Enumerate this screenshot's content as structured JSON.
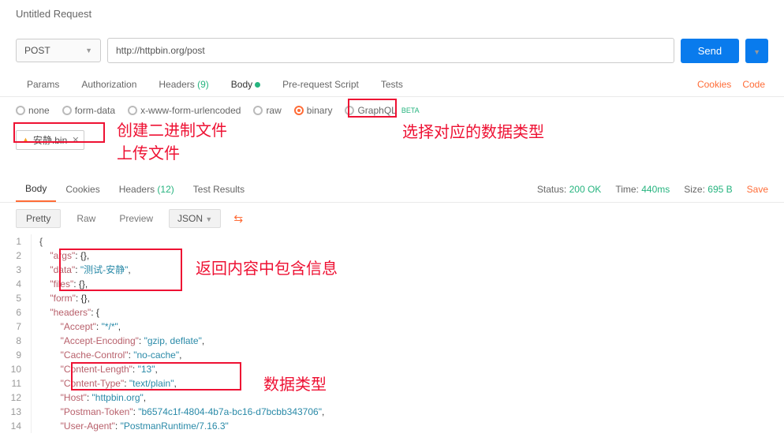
{
  "title": "Untitled Request",
  "request": {
    "method": "POST",
    "url": "http://httpbin.org/post",
    "send_label": "Send"
  },
  "tabs": {
    "params": "Params",
    "auth": "Authorization",
    "headers_label": "Headers",
    "headers_count": "(9)",
    "body": "Body",
    "prerequest": "Pre-request Script",
    "tests": "Tests",
    "cookies": "Cookies",
    "code": "Code"
  },
  "body_types": {
    "none": "none",
    "formdata": "form-data",
    "urlencoded": "x-www-form-urlencoded",
    "raw": "raw",
    "binary": "binary",
    "graphql": "GraphQL",
    "beta": "BETA"
  },
  "file": {
    "name": "安静.bin"
  },
  "annotations": {
    "upload": "创建二进制文件\n上传文件",
    "select_type": "选择对应的数据类型",
    "return_contains": "返回内容中包含信息",
    "data_type": "数据类型"
  },
  "response": {
    "tabs": {
      "body": "Body",
      "cookies": "Cookies",
      "headers_label": "Headers",
      "headers_count": "(12)",
      "test_results": "Test Results"
    },
    "status_label": "Status:",
    "status_val": "200 OK",
    "time_label": "Time:",
    "time_val": "440ms",
    "size_label": "Size:",
    "size_val": "695 B",
    "save": "Save"
  },
  "pretty": {
    "pretty": "Pretty",
    "raw": "Raw",
    "preview": "Preview",
    "json": "JSON"
  },
  "json_body": {
    "args": "{}",
    "data": "测试-安静",
    "files": "{}",
    "form": "{}",
    "headers": {
      "Accept": "*/*",
      "Accept-Encoding": "gzip, deflate",
      "Cache-Control": "no-cache",
      "Content-Length": "13",
      "Content-Type": "text/plain",
      "Host": "httpbin.org",
      "Postman-Token": "b6574c1f-4804-4b7a-bc16-d7bcbb343706",
      "User-Agent": "PostmanRuntime/7.16.3"
    }
  }
}
